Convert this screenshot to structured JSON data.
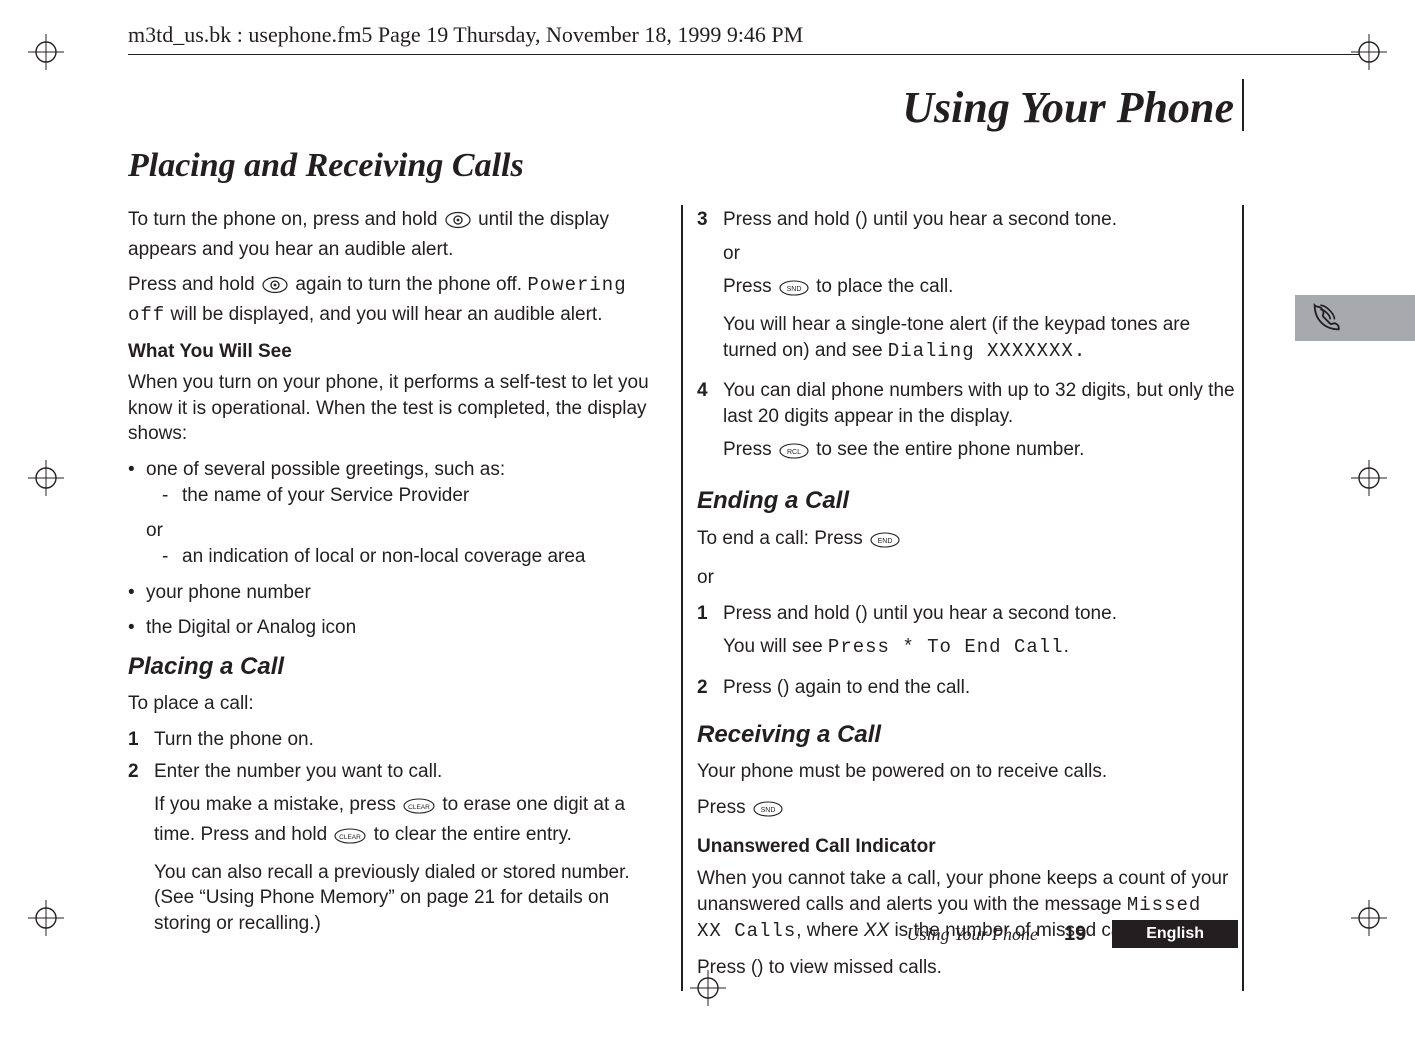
{
  "framemaker_header": "m3td_us.bk : usephone.fm5  Page 19  Thursday, November 18, 1999  9:46 PM",
  "chapter_title": "Using Your Phone",
  "section_title": "Placing and Receiving Calls",
  "col1": {
    "p1a": "To turn the phone on, press and hold ",
    "p1b": " until the display appears and you hear an audible alert.",
    "p2a": "Press and hold ",
    "p2b": " again to turn the phone off. ",
    "p2_lcd": "Powering off",
    "p2c": " will be displayed, and you will hear an audible alert.",
    "h_what": "What You Will See",
    "p3": "When you turn on your phone, it performs a self-test to let you know it is operational. When the test is completed, the display shows:",
    "bul1": "one of several possible greetings, such as:",
    "dash1": "the name of your Service Provider",
    "or1": "or",
    "dash2": "an indication of local or non-local coverage area",
    "bul2": "your phone number",
    "bul3": "the Digital or Analog icon",
    "h_placing": "Placing a Call",
    "p_place": "To place a call:",
    "s1": "Turn the phone on.",
    "s2": "Enter the number you want to call.",
    "s2_p1a": "If you make a mistake, press ",
    "s2_p1b": " to erase one digit at a time. Press and hold ",
    "s2_p1c": " to clear the entire entry.",
    "s2_p2": "You can also recall a previously dialed or stored number. (See “Using Phone Memory” on page 21 for details on storing or recalling.)"
  },
  "col2": {
    "s3a": "Press and hold ",
    "s3a_key": "()",
    "s3b": " until you hear a second tone.",
    "or": "or",
    "s3c": "Press ",
    "s3d": " to place the call.",
    "s3e_a": "You will hear a single-tone alert (if the keypad tones are turned on) and see ",
    "s3e_lcd": "Dialing XXXXXXX.",
    "s4a": "You can dial phone numbers with up to 32 digits, but only the last 20 digits appear in the display.",
    "s4b_a": "Press ",
    "s4b_b": " to see the entire phone number.",
    "h_end": "Ending a Call",
    "end_p1a": "To end a call: Press ",
    "or2": "or",
    "end_s1a": "Press and hold ",
    "end_s1a_key": "()",
    "end_s1b": " until you hear a second tone.",
    "end_s1c_a": "You will see ",
    "end_s1c_lcd": "Press * To End Call",
    "end_s1c_b": ".",
    "end_s2a": "Press ",
    "end_s2a_key": "()",
    "end_s2b": " again to end the call.",
    "h_recv": "Receiving a Call",
    "recv_p1": "Your phone must be powered on to receive calls.",
    "recv_p2": "Press ",
    "h_unans": "Unanswered Call Indicator",
    "unans_p1a": "When you cannot take a call, your phone keeps a count of your unanswered calls and alerts you with the message ",
    "unans_lcd": "Missed XX Calls",
    "unans_p1b": ", where ",
    "unans_xx": "XX",
    "unans_p1c": " is the number of missed calls.",
    "unans_p2a": "Press ",
    "unans_p2_key": "()",
    "unans_p2b": " to view missed calls."
  },
  "footer": {
    "running": "Using Your Phone",
    "page": "19",
    "lang": "English"
  },
  "icons": {
    "power": "power-key-icon",
    "clear": "clear-key-icon",
    "snd": "snd-key-icon",
    "rcl": "rcl-key-icon",
    "end": "end-key-icon",
    "phone": "phone-icon"
  }
}
